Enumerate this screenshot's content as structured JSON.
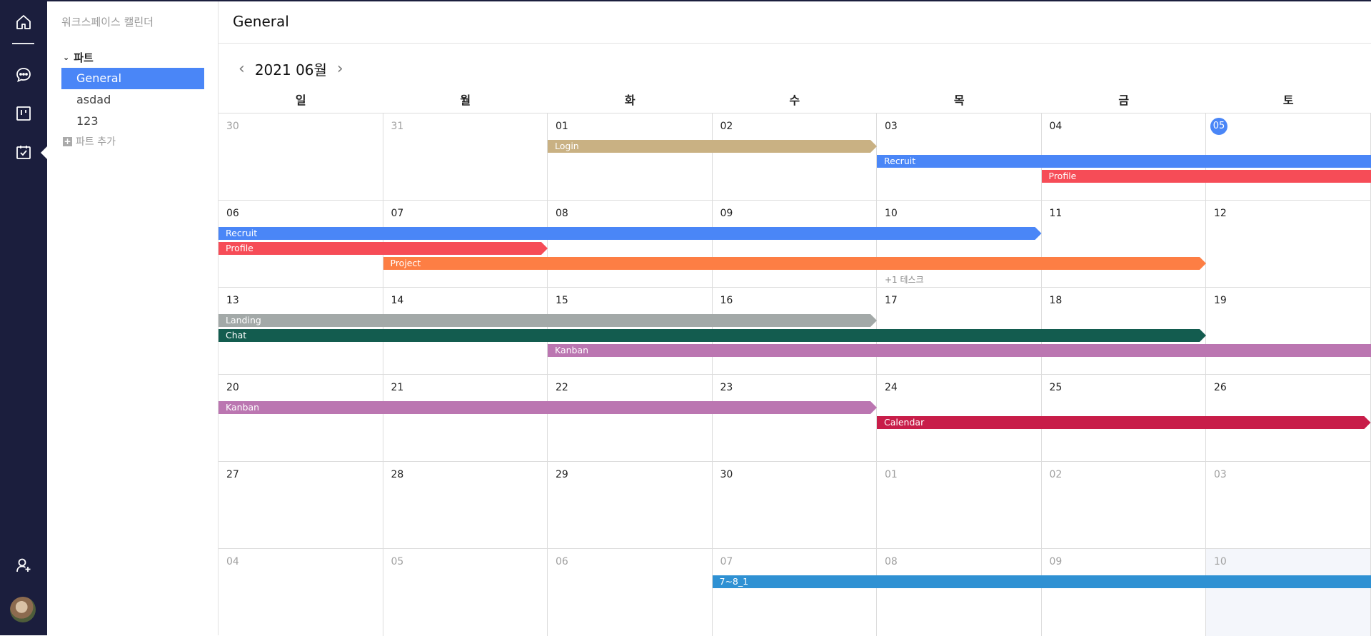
{
  "sidebar": {
    "workspace_title": "워크스페이스 캘린더",
    "section_label": "파트",
    "items": [
      {
        "label": "General",
        "active": true
      },
      {
        "label": "asdad",
        "active": false
      },
      {
        "label": "123",
        "active": false
      }
    ],
    "add_label": "파트 추가"
  },
  "header": {
    "title": "General"
  },
  "calendar": {
    "month_label": "2021 06월",
    "weekdays": [
      "일",
      "월",
      "화",
      "수",
      "목",
      "금",
      "토"
    ],
    "today_color": "#4a86f7",
    "weeks": [
      {
        "days": [
          {
            "n": "30",
            "muted": true
          },
          {
            "n": "31",
            "muted": true
          },
          {
            "n": "01"
          },
          {
            "n": "02"
          },
          {
            "n": "03"
          },
          {
            "n": "04"
          },
          {
            "n": "05",
            "today": true
          }
        ]
      },
      {
        "days": [
          {
            "n": "06"
          },
          {
            "n": "07"
          },
          {
            "n": "08"
          },
          {
            "n": "09"
          },
          {
            "n": "10"
          },
          {
            "n": "11"
          },
          {
            "n": "12"
          }
        ],
        "more": {
          "label": "+1 테스크",
          "day": 4
        }
      },
      {
        "days": [
          {
            "n": "13"
          },
          {
            "n": "14"
          },
          {
            "n": "15"
          },
          {
            "n": "16"
          },
          {
            "n": "17"
          },
          {
            "n": "18"
          },
          {
            "n": "19"
          }
        ]
      },
      {
        "days": [
          {
            "n": "20"
          },
          {
            "n": "21"
          },
          {
            "n": "22"
          },
          {
            "n": "23"
          },
          {
            "n": "24"
          },
          {
            "n": "25"
          },
          {
            "n": "26"
          }
        ]
      },
      {
        "days": [
          {
            "n": "27"
          },
          {
            "n": "28"
          },
          {
            "n": "29"
          },
          {
            "n": "30"
          },
          {
            "n": "01",
            "muted": true
          },
          {
            "n": "02",
            "muted": true
          },
          {
            "n": "03",
            "muted": true
          }
        ]
      },
      {
        "days": [
          {
            "n": "04",
            "muted": true
          },
          {
            "n": "05",
            "muted": true
          },
          {
            "n": "06",
            "muted": true
          },
          {
            "n": "07",
            "muted": true
          },
          {
            "n": "08",
            "muted": true
          },
          {
            "n": "09",
            "muted": true
          },
          {
            "n": "10",
            "muted": true,
            "shaded": true
          }
        ]
      }
    ],
    "events": [
      {
        "week": 0,
        "lane": 0,
        "start": 2,
        "end": 3,
        "label": "Login",
        "color": "#c9b183",
        "ends_here": true
      },
      {
        "week": 0,
        "lane": 1,
        "start": 4,
        "end": 6,
        "label": "Recruit",
        "color": "#4a86f7",
        "ends_here": false
      },
      {
        "week": 0,
        "lane": 2,
        "start": 5,
        "end": 6,
        "label": "Profile",
        "color": "#f64c57",
        "ends_here": false
      },
      {
        "week": 1,
        "lane": 0,
        "start": 0,
        "end": 4,
        "label": "Recruit",
        "color": "#4a86f7",
        "ends_here": true
      },
      {
        "week": 1,
        "lane": 1,
        "start": 0,
        "end": 1,
        "label": "Profile",
        "color": "#f64c57",
        "ends_here": true
      },
      {
        "week": 1,
        "lane": 2,
        "start": 1,
        "end": 5,
        "label": "Project",
        "color": "#fd7e44",
        "ends_here": true
      },
      {
        "week": 2,
        "lane": 0,
        "start": 0,
        "end": 3,
        "label": "Landing",
        "color": "#a3a9a8",
        "ends_here": true
      },
      {
        "week": 2,
        "lane": 1,
        "start": 0,
        "end": 5,
        "label": "Chat",
        "color": "#135c4f",
        "ends_here": true
      },
      {
        "week": 2,
        "lane": 2,
        "start": 2,
        "end": 6,
        "label": "Kanban",
        "color": "#bb76b1",
        "ends_here": false
      },
      {
        "week": 3,
        "lane": 0,
        "start": 0,
        "end": 3,
        "label": "Kanban",
        "color": "#bb76b1",
        "ends_here": true
      },
      {
        "week": 3,
        "lane": 1,
        "start": 4,
        "end": 6,
        "label": "Calendar",
        "color": "#c81d49",
        "ends_here": true
      },
      {
        "week": 5,
        "lane": 0,
        "start": 3,
        "end": 6,
        "label": "7~8_1",
        "color": "#2f91d3",
        "ends_here": false
      }
    ]
  },
  "icons": [
    "home-icon",
    "chat-icon",
    "kanban-icon",
    "calendar-check-icon",
    "user-add-icon"
  ]
}
